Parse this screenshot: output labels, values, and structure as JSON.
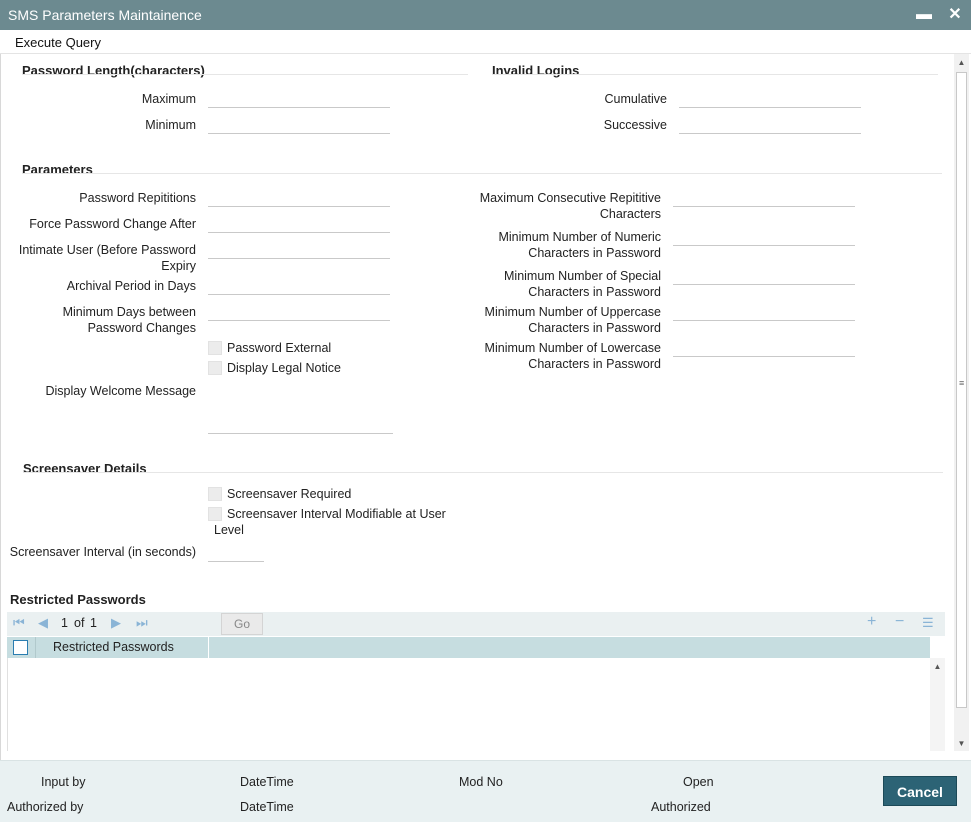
{
  "window": {
    "title": "SMS Parameters Maintainence"
  },
  "menu": {
    "execute_query": "Execute Query"
  },
  "password_length": {
    "title": "Password Length(characters)",
    "maximum_label": "Maximum",
    "minimum_label": "Minimum"
  },
  "invalid_logins": {
    "title": "Invalid Logins",
    "cumulative_label": "Cumulative",
    "successive_label": "Successive"
  },
  "parameters": {
    "title": "Parameters",
    "password_repititions": "Password Repititions",
    "force_password_change": "Force Password Change After",
    "intimate_user": "Intimate User (Before Password Expiry",
    "archival_period": "Archival Period in Days",
    "min_days_between": "Minimum Days between Password Changes",
    "password_external": "Password External",
    "display_legal_notice": "Display Legal Notice",
    "display_welcome_message": "Display Welcome Message",
    "max_consecutive_repititive": "Maximum Consecutive Repititive Characters",
    "min_numeric": "Minimum Number of Numeric Characters in Password",
    "min_special": "Minimum Number of Special Characters in Password",
    "min_uppercase": "Minimum Number of Uppercase Characters in Password",
    "min_lowercase": "Minimum Number of Lowercase Characters in Password"
  },
  "screensaver": {
    "title": "Screensaver Details",
    "required_label": "Screensaver Required",
    "modifiable_label": "Screensaver Interval Modifiable at User Level",
    "interval_label": "Screensaver Interval (in seconds)"
  },
  "restricted": {
    "title": "Restricted Passwords",
    "page_current": "1",
    "page_of": "of",
    "page_total": "1",
    "go_label": "Go",
    "column_header": "Restricted Passwords"
  },
  "footer": {
    "input_by": "Input by",
    "datetime_1": "DateTime",
    "mod_no": "Mod No",
    "open": "Open",
    "authorized_by": "Authorized by",
    "datetime_2": "DateTime",
    "authorized": "Authorized",
    "cancel_label": "Cancel"
  },
  "colors": {
    "titlebar": "#6c8a90",
    "cancel_button": "#2c6375",
    "grid_header": "#c6dde0",
    "footer_bg": "#e9f1f2"
  }
}
